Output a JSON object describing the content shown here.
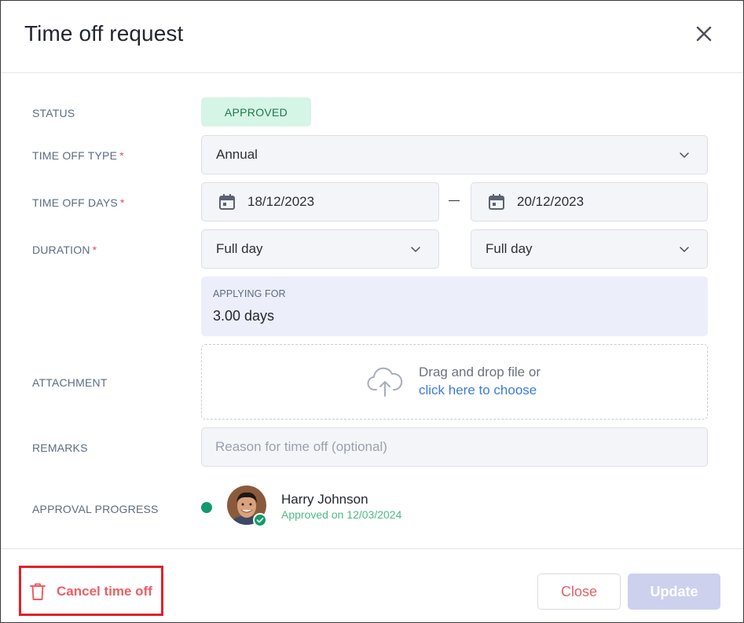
{
  "dialog": {
    "title": "Time off request",
    "close_icon": "close-icon"
  },
  "form": {
    "status": {
      "label": "STATUS",
      "value": "APPROVED"
    },
    "type": {
      "label": "TIME OFF TYPE",
      "required_mark": "*",
      "value": "Annual"
    },
    "days": {
      "label": "TIME OFF DAYS",
      "required_mark": "*",
      "start": "18/12/2023",
      "separator": "–",
      "end": "20/12/2023"
    },
    "duration": {
      "label": "DURATION",
      "required_mark": "*",
      "start": "Full day",
      "end": "Full day"
    },
    "applying": {
      "label": "APPLYING FOR",
      "value": "3.00 days"
    },
    "attachment": {
      "label": "ATTACHMENT",
      "drop_text": "Drag and drop file or",
      "choose_link": "click here to choose"
    },
    "remarks": {
      "label": "REMARKS",
      "placeholder": "Reason for time off (optional)"
    },
    "approval": {
      "label": "APPROVAL PROGRESS",
      "name": "Harry Johnson",
      "status": "Approved on 12/03/2024"
    }
  },
  "footer": {
    "cancel_label": "Cancel time off",
    "close_label": "Close",
    "update_label": "Update"
  },
  "colors": {
    "status_bg": "#d5f5e6",
    "status_text": "#1f7a43",
    "link": "#3d7be0",
    "danger": "#ec5f63",
    "success": "#129b6a",
    "update_disabled": "#cdd1ee"
  }
}
